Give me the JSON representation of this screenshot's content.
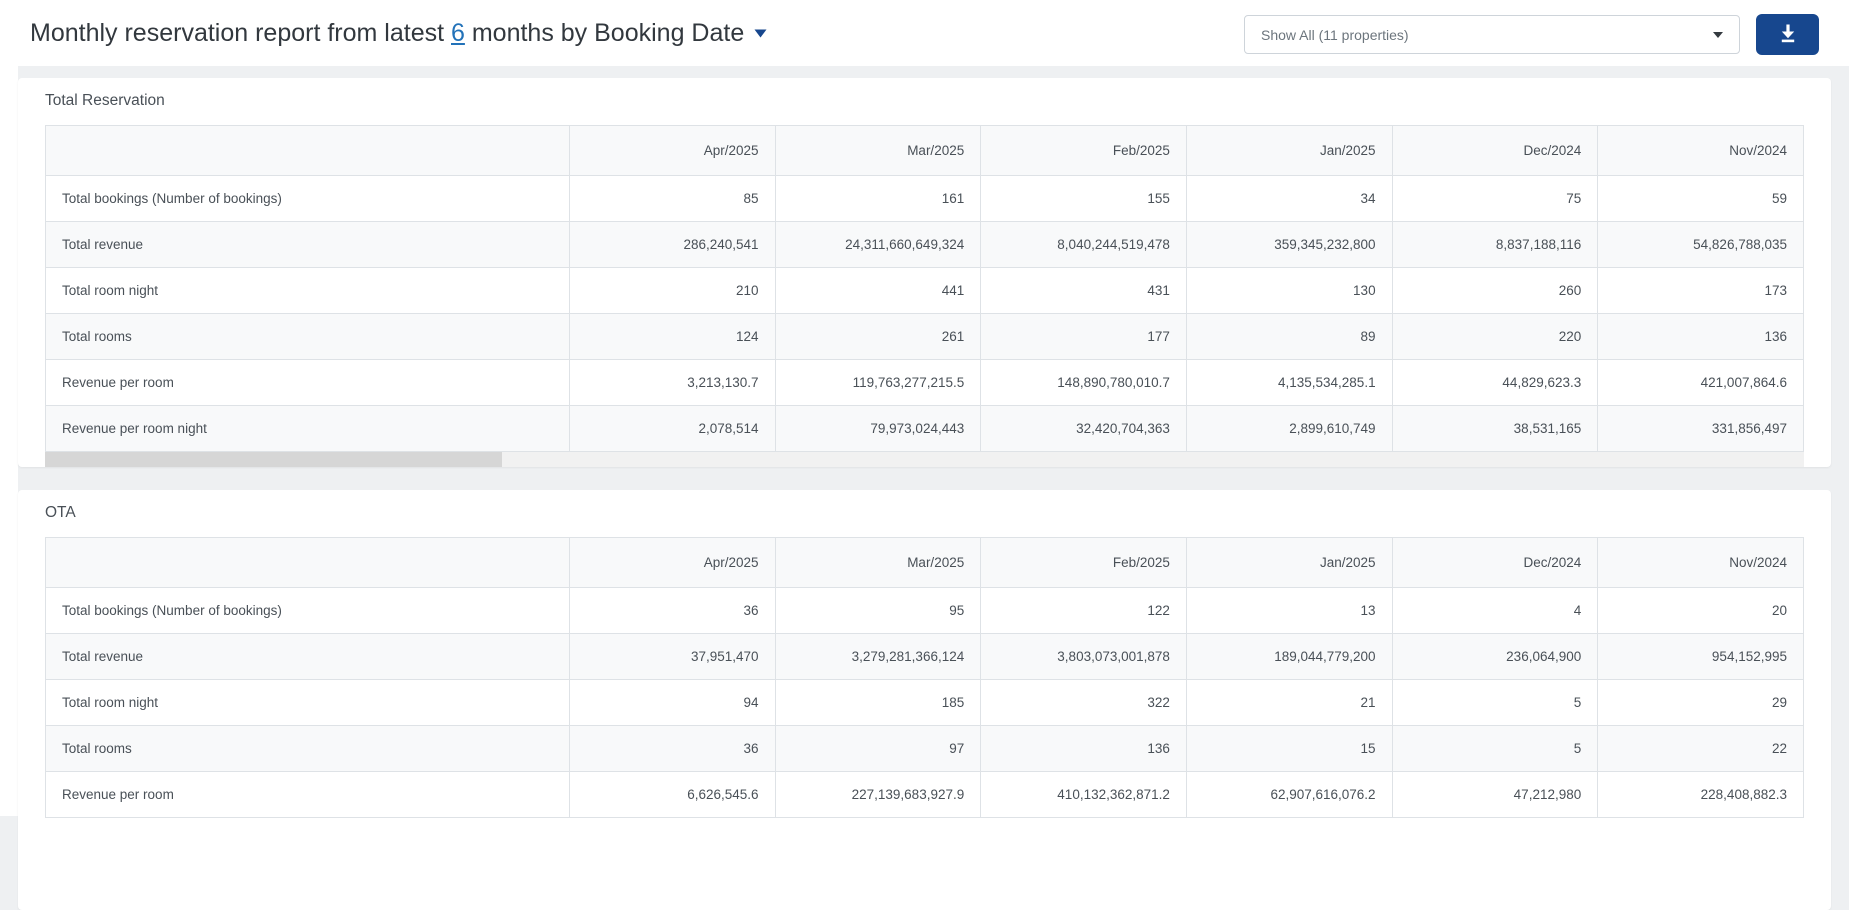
{
  "header": {
    "title": {
      "prefix": "Monthly reservation report from latest ",
      "link": "6",
      "suffix": " months by Booking Date"
    },
    "property_select": {
      "value": "Show All (11 properties)"
    },
    "download_button": {
      "icon": "download-icon"
    }
  },
  "colors": {
    "accent": "#17478E",
    "link_blue": "#2272B9",
    "table_border": "#dee2e6",
    "stripe": "#f8f9fa",
    "text": "#495057"
  },
  "columns": [
    "Apr/2025",
    "Mar/2025",
    "Feb/2025",
    "Jan/2025",
    "Dec/2024",
    "Nov/2024"
  ],
  "sections": [
    {
      "title": "Total Reservation",
      "rows": [
        {
          "label": "Total bookings (Number of bookings)",
          "values": [
            "85",
            "161",
            "155",
            "34",
            "75",
            "59"
          ]
        },
        {
          "label": "Total revenue",
          "values": [
            "286,240,541",
            "24,311,660,649,324",
            "8,040,244,519,478",
            "359,345,232,800",
            "8,837,188,116",
            "54,826,788,035"
          ]
        },
        {
          "label": "Total room night",
          "values": [
            "210",
            "441",
            "431",
            "130",
            "260",
            "173"
          ]
        },
        {
          "label": "Total rooms",
          "values": [
            "124",
            "261",
            "177",
            "89",
            "220",
            "136"
          ]
        },
        {
          "label": "Revenue per room",
          "values": [
            "3,213,130.7",
            "119,763,277,215.5",
            "148,890,780,010.7",
            "4,135,534,285.1",
            "44,829,623.3",
            "421,007,864.6"
          ]
        },
        {
          "label": "Revenue per room night",
          "values": [
            "2,078,514",
            "79,973,024,443",
            "32,420,704,363",
            "2,899,610,749",
            "38,531,165",
            "331,856,497"
          ]
        }
      ]
    },
    {
      "title": "OTA",
      "rows": [
        {
          "label": "Total bookings (Number of bookings)",
          "values": [
            "36",
            "95",
            "122",
            "13",
            "4",
            "20"
          ]
        },
        {
          "label": "Total revenue",
          "values": [
            "37,951,470",
            "3,279,281,366,124",
            "3,803,073,001,878",
            "189,044,779,200",
            "236,064,900",
            "954,152,995"
          ]
        },
        {
          "label": "Total room night",
          "values": [
            "94",
            "185",
            "322",
            "21",
            "5",
            "29"
          ]
        },
        {
          "label": "Total rooms",
          "values": [
            "36",
            "97",
            "136",
            "15",
            "5",
            "22"
          ]
        },
        {
          "label": "Revenue per room",
          "values": [
            "6,626,545.6",
            "227,139,683,927.9",
            "410,132,362,871.2",
            "62,907,616,076.2",
            "47,212,980",
            "228,408,882.3"
          ]
        }
      ]
    }
  ]
}
